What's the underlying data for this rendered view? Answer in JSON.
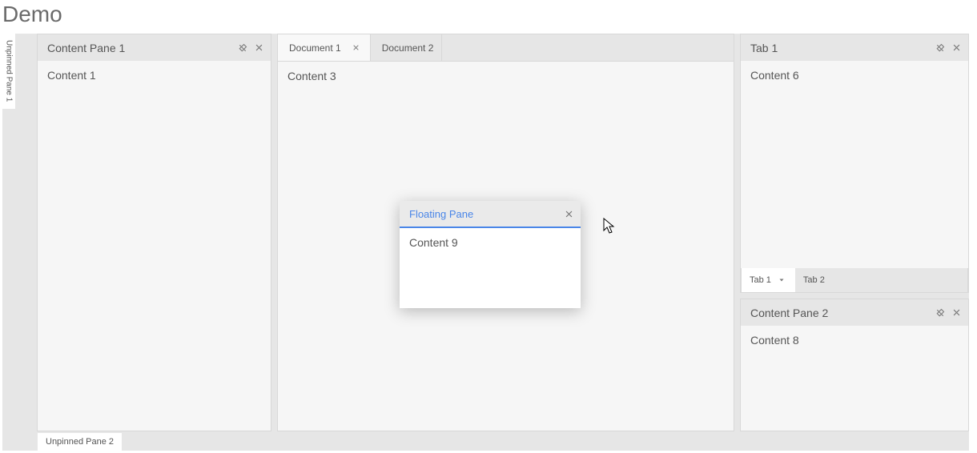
{
  "page_title": "Demo",
  "unpinned": {
    "left_tab": "Unpinned Pane 1",
    "bottom_tab": "Unpinned Pane 2"
  },
  "left_pane": {
    "title": "Content Pane 1",
    "body": "Content 1"
  },
  "center": {
    "tabs": [
      {
        "label": "Document 1",
        "active": true
      },
      {
        "label": "Document 2",
        "active": false
      }
    ],
    "body": "Content 3"
  },
  "right": {
    "top_pane": {
      "header_title": "Tab 1",
      "body": "Content 6",
      "bottom_tabs": [
        {
          "label": "Tab 1",
          "active": true
        },
        {
          "label": "Tab 2",
          "active": false
        }
      ]
    },
    "bottom_pane": {
      "title": "Content Pane 2",
      "body": "Content 8"
    }
  },
  "floating": {
    "title": "Floating Pane",
    "body": "Content 9"
  }
}
